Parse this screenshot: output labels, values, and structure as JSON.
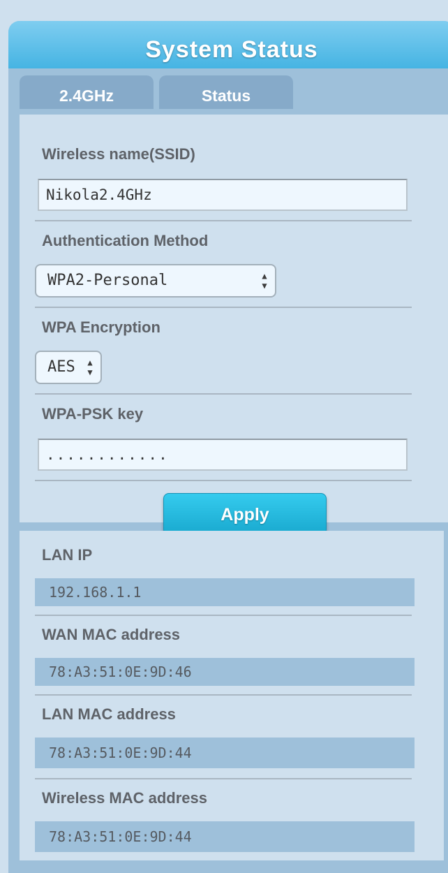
{
  "panel": {
    "title": "System Status"
  },
  "tabs": [
    {
      "label": "2.4GHz"
    },
    {
      "label": "Status"
    }
  ],
  "wireless": {
    "ssid_label": "Wireless name(SSID)",
    "ssid_value": "Nikola2.4GHz",
    "auth_label": "Authentication Method",
    "auth_value": "WPA2-Personal",
    "encryption_label": "WPA Encryption",
    "encryption_value": "AES",
    "psk_label": "WPA-PSK key",
    "psk_value": "............",
    "apply_label": "Apply"
  },
  "status": {
    "items": [
      {
        "label": "LAN IP",
        "value": "192.168.1.1"
      },
      {
        "label": "WAN MAC address",
        "value": "78:A3:51:0E:9D:46"
      },
      {
        "label": "LAN MAC address",
        "value": "78:A3:51:0E:9D:44"
      },
      {
        "label": "Wireless MAC address",
        "value": "78:A3:51:0E:9D:44"
      }
    ]
  },
  "icons": {
    "select_arrows": "up-down-arrows-icon"
  },
  "colors": {
    "header_gradient_top": "#7fcdf0",
    "header_gradient_bottom": "#45b4e3",
    "apply_button": "#19a9cf",
    "panel_bg": "#9ec0da",
    "card_bg": "#cfe0ee"
  }
}
